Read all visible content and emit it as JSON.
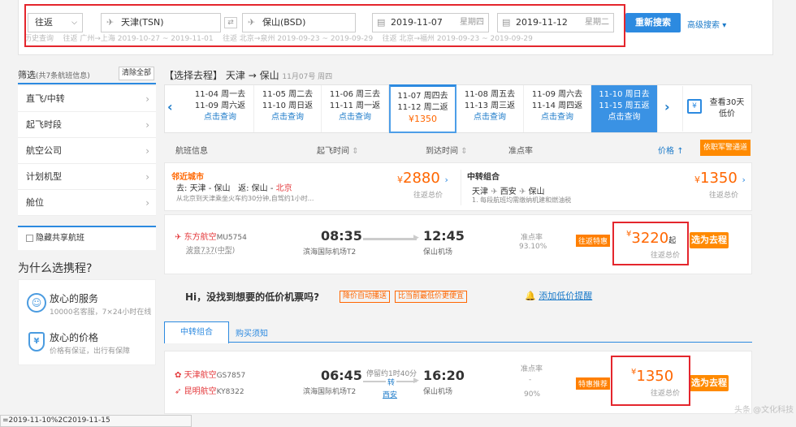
{
  "search": {
    "trip_type": "往返",
    "from": "天津(TSN)",
    "to": "保山(BSD)",
    "depart_date": "2019-11-07",
    "depart_weekday": "星期四",
    "return_date": "2019-11-12",
    "return_weekday": "星期二",
    "search_btn": "重新搜索",
    "advanced": "高级搜索",
    "history": [
      "历史查询",
      "往返 广州→上海 2019-10-27 ~ 2019-11-01",
      "往返 北京→泉州 2019-09-23 ~ 2019-09-29",
      "往返 北京→福州 2019-09-23 ~ 2019-09-29"
    ]
  },
  "sidebar": {
    "filter_title": "筛选",
    "filter_count": "(共7条航班信息)",
    "clear_all": "清除全部",
    "items": [
      "直飞/中转",
      "起飞时段",
      "航空公司",
      "计划机型",
      "舱位"
    ],
    "hide_shared": "隐藏共享航班",
    "why_title": "为什么选携程?",
    "benefits": [
      {
        "title": "放心的服务",
        "desc": "10000名客服，7×24小时在线"
      },
      {
        "title": "放心的价格",
        "desc": "价格有保证，出行有保障"
      }
    ]
  },
  "route": {
    "label": "【选择去程】",
    "from": "天津",
    "arrow": "→",
    "to": "保山",
    "date": "11月07号 周四"
  },
  "dates": [
    {
      "d1": "11-04 周一去",
      "d2": "11-09 周六返",
      "q": "点击查询"
    },
    {
      "d1": "11-05 周二去",
      "d2": "11-10 周日返",
      "q": "点击查询"
    },
    {
      "d1": "11-06 周三去",
      "d2": "11-11 周一返",
      "q": "点击查询"
    },
    {
      "d1": "11-07 周四去",
      "d2": "11-12 周二返",
      "price": "¥1350"
    },
    {
      "d1": "11-08 周五去",
      "d2": "11-13 周三返",
      "q": "点击查询"
    },
    {
      "d1": "11-09 周六去",
      "d2": "11-14 周四返",
      "q": "点击查询"
    },
    {
      "d1": "11-10 周日去",
      "d2": "11-15 周五返",
      "q": "点击查询"
    }
  ],
  "calendar30": "查看30天 低价",
  "columns": {
    "flight": "航班信息",
    "depart": "起飞时间",
    "arrive": "到达时间",
    "ontime": "准点率",
    "price": "价格",
    "military": "依职军警通道"
  },
  "nearby": {
    "title": "邻近城市",
    "go_label": "去:",
    "go_from": "天津",
    "go_to": "保山",
    "back_label": "返:",
    "back_from": "保山",
    "back_to": "北京",
    "note": "从北京到天津乘坐火车约30分钟,自驾约1小时...",
    "price": "2880",
    "price_note": "往返总价"
  },
  "transfer_combo": {
    "title": "中转组合",
    "a": "天津",
    "b": "西安",
    "c": "保山",
    "note": "1. 每段航班均需缴纳机建和燃油税",
    "price": "1350",
    "price_note": "往返总价"
  },
  "flight1": {
    "airline": "东方航空",
    "code": "MU5754",
    "plane": "波音737(中型)",
    "dep_time": "08:35",
    "dep_airport": "滨海国际机场T2",
    "arr_time": "12:45",
    "arr_airport": "保山机场",
    "ontime_label": "准点率",
    "ontime": "93.10%",
    "tag": "往返特惠",
    "price": "3220",
    "price_suffix": "起",
    "price_note": "往返总价",
    "choose": "选为去程"
  },
  "lowprice": {
    "text": "Hi，没找到想要的低价机票吗?",
    "tag1": "降价自动播送",
    "tag2": "比当前最低价更便宜",
    "link": "添加低价提醒"
  },
  "tabs": {
    "t1": "中转组合",
    "t2": "购买须知"
  },
  "flight2": {
    "airline1": "天津航空",
    "code1": "GS7857",
    "airline2": "昆明航空",
    "code2": "KY8322",
    "dep_time": "06:45",
    "dep_airport": "滨海国际机场T2",
    "stop_note": "停留约1时40分",
    "transfer": "转",
    "transfer_city": "西安",
    "arr_time": "16:20",
    "arr_airport": "保山机场",
    "ontime_label": "准点率",
    "ontime_dash": "-",
    "ontime": "90%",
    "tag": "特惠推荐",
    "price": "1350",
    "price_note": "往返总价",
    "choose": "选为去程"
  },
  "status_url": "=2019-11-10%2C2019-11-15",
  "watermark": "头条 @文化科技"
}
